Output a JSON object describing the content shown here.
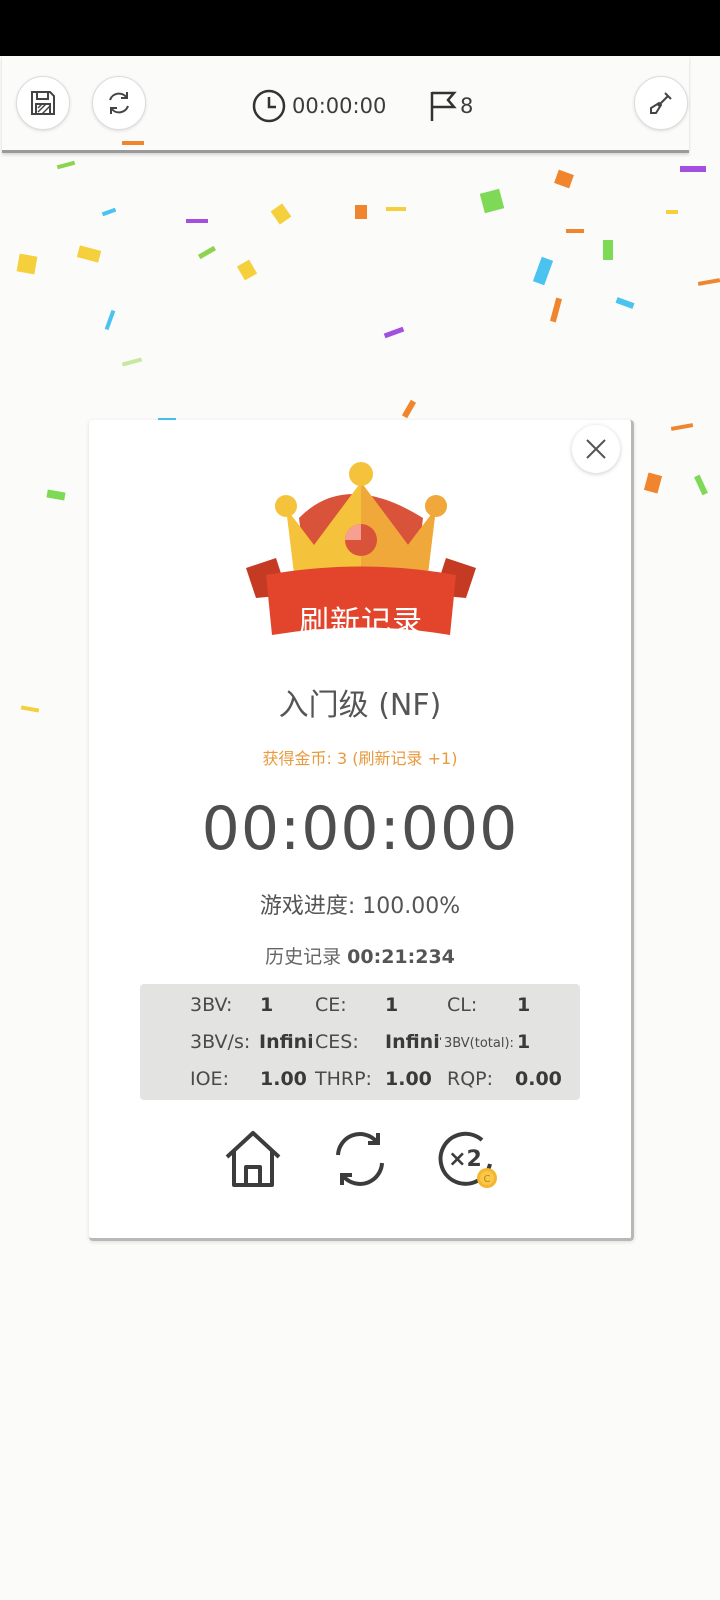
{
  "toolbar": {
    "timer": "00:00:00",
    "flags": "8",
    "icons": [
      "save-icon",
      "refresh-icon",
      "clock-icon",
      "flag-icon",
      "shovel-icon"
    ]
  },
  "dialog": {
    "banner": "刷新记录",
    "level": "入门级 (NF)",
    "coins": "获得金币: 3 (刷新记录 +1)",
    "time": "00:00:000",
    "progress_label": "游戏进度:",
    "progress_value": "100.00%",
    "history_label": "历史记录",
    "history_value": "00:21:234",
    "stats": [
      [
        {
          "label": "3BV:",
          "value": "1"
        },
        {
          "label": "CE:",
          "value": "1"
        },
        {
          "label": "CL:",
          "value": "1"
        }
      ],
      [
        {
          "label": "3BV/s:",
          "value": "Infini"
        },
        {
          "label": "CES:",
          "value": "Infinit"
        },
        {
          "label": "3BV(total):",
          "value": "1"
        }
      ],
      [
        {
          "label": "IOE:",
          "value": "1.00"
        },
        {
          "label": "THRP:",
          "value": "1.00"
        },
        {
          "label": "RQP:",
          "value": "0.00"
        }
      ]
    ],
    "actions": {
      "double_label": "×2",
      "coin_label": "C",
      "icons": [
        "home-icon",
        "replay-icon",
        "double-reward-icon",
        "close-icon"
      ]
    }
  },
  "colors": {
    "crown_yellow": "#f5c33b",
    "crown_red": "#d9533a",
    "banner": "#e2452b",
    "coins_text": "#e89a3c",
    "stats_bg": "#e3e3e1"
  }
}
